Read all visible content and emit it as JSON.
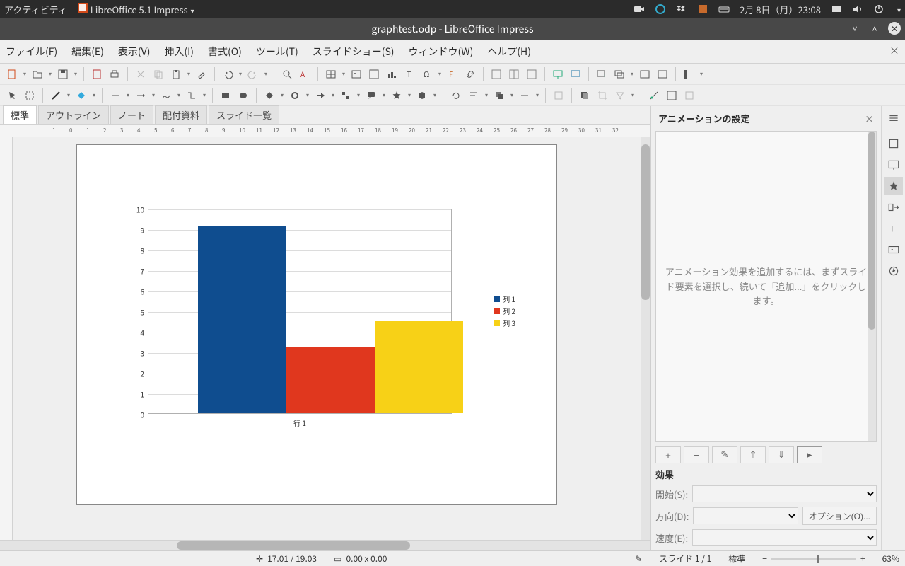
{
  "topbar": {
    "activities": "アクティビティ",
    "app": "LibreOffice 5.1 Impress",
    "date": "2月 8日（月）23:08"
  },
  "titlebar": {
    "title": "graphtest.odp - LibreOffice Impress"
  },
  "menubar": {
    "file": "ファイル(F)",
    "edit": "編集(E)",
    "view": "表示(V)",
    "insert": "挿入(I)",
    "format": "書式(O)",
    "tools": "ツール(T)",
    "slideshow": "スライドショー(S)",
    "window": "ウィンドウ(W)",
    "help": "ヘルプ(H)"
  },
  "viewtabs": {
    "normal": "標準",
    "outline": "アウトライン",
    "notes": "ノート",
    "handout": "配付資料",
    "sorter": "スライド一覧"
  },
  "anim": {
    "title": "アニメーションの設定",
    "hint": "アニメーション効果を追加するには、まずスライド要素を選択し、続いて「追加...」をクリックします。",
    "effects_hdr": "効果",
    "start_lbl": "開始(S):",
    "dir_lbl": "方向(D):",
    "speed_lbl": "速度(E):",
    "options_btn": "オプション(O)..."
  },
  "status": {
    "coords": "17.01 / 19.03",
    "size": "0.00 x 0.00",
    "slide": "スライド 1 / 1",
    "mode": "標準",
    "zoom": "63%"
  },
  "chart_data": {
    "type": "bar",
    "categories": [
      "行 1"
    ],
    "series": [
      {
        "name": "列 1",
        "values": [
          9.1
        ],
        "color": "#0f4d8f"
      },
      {
        "name": "列 2",
        "values": [
          3.2
        ],
        "color": "#e0371e"
      },
      {
        "name": "列 3",
        "values": [
          4.5
        ],
        "color": "#f7d117"
      }
    ],
    "ylim": [
      0,
      10
    ],
    "yticks": [
      0,
      1,
      2,
      3,
      4,
      5,
      6,
      7,
      8,
      9,
      10
    ],
    "xlabel_category": "行 1",
    "legend": [
      "列 1",
      "列 2",
      "列 3"
    ],
    "legend_colors": [
      "#0f4d8f",
      "#e0371e",
      "#f7d117"
    ]
  }
}
